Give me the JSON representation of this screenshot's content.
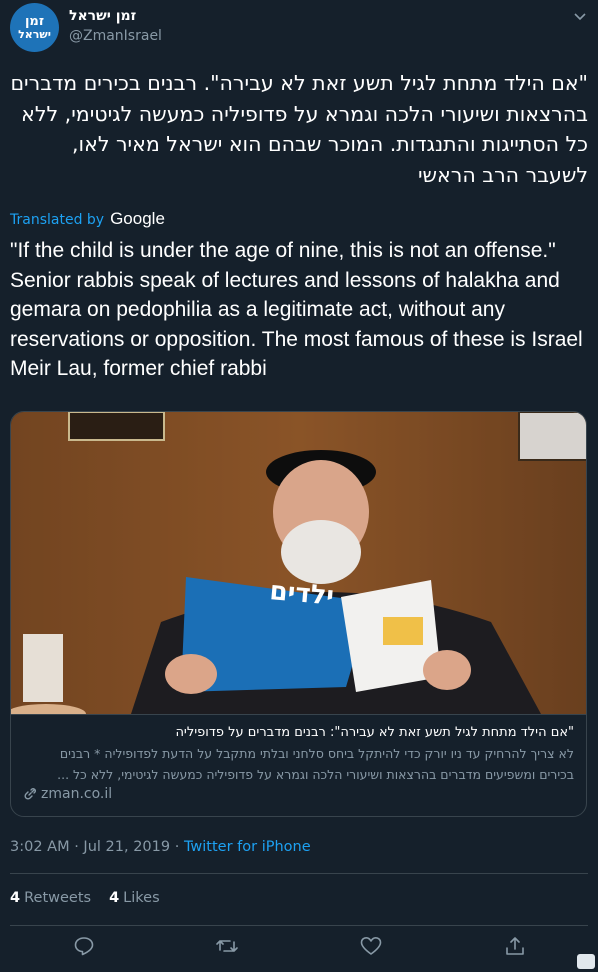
{
  "account": {
    "display_name": "זמן ישראל",
    "handle": "@ZmanIsrael",
    "avatar_line1": "זמן",
    "avatar_line2": "ישראל"
  },
  "tweet": {
    "hebrew_text": "\"אם הילד מתחת לגיל תשע זאת לא עבירה\". רבנים בכירים מדברים בהרצאות ושיעורי הלכה וגמרא על פדופיליה כמעשה לגיטימי, ללא כל הסתייגות והתנגדות. המוכר שבהם הוא ישראל מאיר לאו, לשעבר הרב הראשי",
    "translated_by": "Translated by",
    "translator": "Google",
    "english_text": "\"If the child is under the age of nine, this is not an offense.\" Senior rabbis speak of lectures and lessons of halakha and gemara on pedophilia as a legitimate act, without any reservations or opposition. The most famous of these is Israel Meir Lau, former chief rabbi"
  },
  "card": {
    "image_magazine_title": "ילדים",
    "title": "\"אם הילד מתחת לגיל תשע זאת לא עבירה\": רבנים מדברים על פדופיליה",
    "description": "לא צריך להרחיק עד ניו יורק כדי להיתקל ביחס סלחני ובלתי מתקבל על הדעת לפדופיליה * רבנים בכירים ומשפיעים מדברים בהרצאות ושיעורי הלכה וגמרא על פדופיליה כמעשה לגיטימי, ללא כל ...",
    "domain": "zman.co.il"
  },
  "meta": {
    "time": "3:02 AM · Jul 21, 2019 · ",
    "source": "Twitter for iPhone"
  },
  "stats": {
    "retweets_count": "4",
    "retweets_label": "Retweets",
    "likes_count": "4",
    "likes_label": "Likes"
  },
  "colors": {
    "background": "#15202b",
    "accent": "#1da1f2",
    "secondary_text": "#8899a6",
    "border": "#38444d",
    "avatar": "#1e73b8"
  },
  "icons": [
    "chevron-down-icon",
    "link-icon",
    "reply-icon",
    "retweet-icon",
    "like-icon",
    "share-icon"
  ]
}
